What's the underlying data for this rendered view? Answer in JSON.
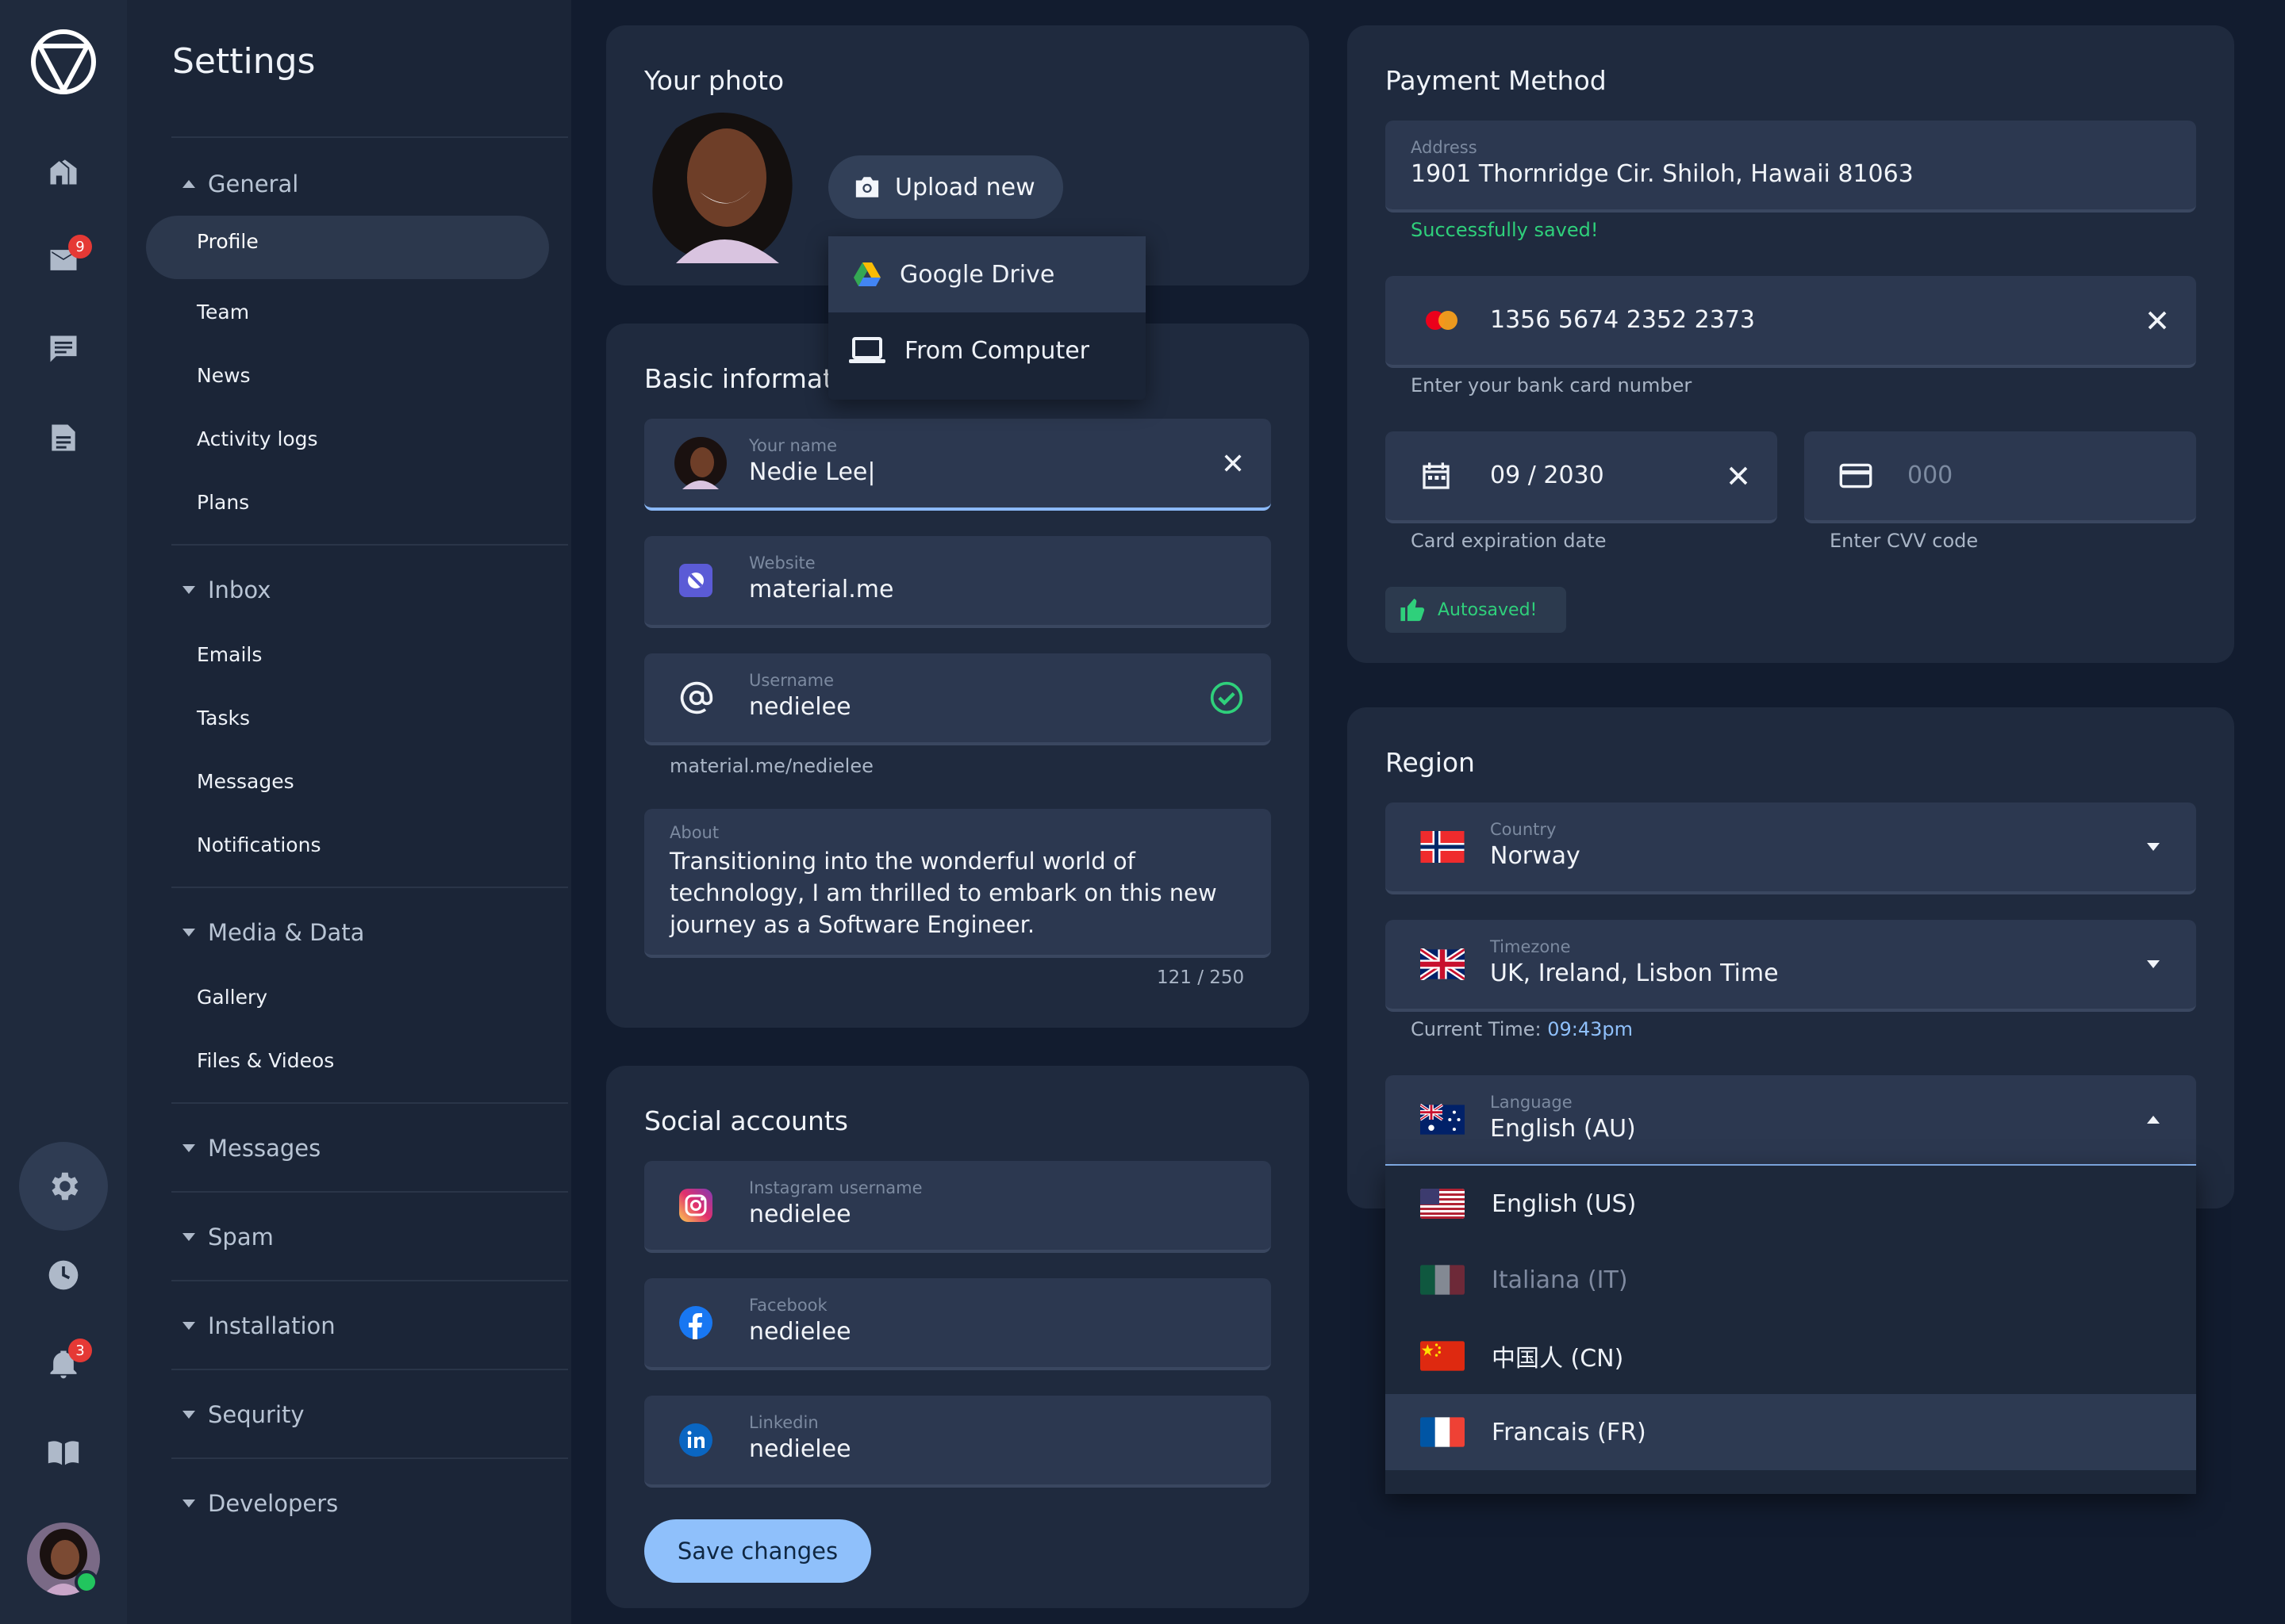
{
  "rail": {
    "mail_badge": "9",
    "bell_badge": "3",
    "icons": [
      "logo-icon",
      "home-icon",
      "mail-icon",
      "chat-icon",
      "document-icon",
      "settings-icon",
      "clock-icon",
      "bell-icon",
      "book-icon"
    ]
  },
  "nav": {
    "title": "Settings",
    "groups": [
      {
        "label": "General",
        "items": [
          "Profile",
          "Team",
          "News",
          "Activity logs",
          "Plans"
        ]
      },
      {
        "label": "Inbox",
        "items": [
          "Emails",
          "Tasks",
          "Messages",
          "Notifications"
        ]
      },
      {
        "label": "Media & Data",
        "items": [
          "Gallery",
          "Files & Videos"
        ]
      },
      {
        "label": "Messages"
      },
      {
        "label": "Spam"
      },
      {
        "label": "Installation"
      },
      {
        "label": "Sequrity"
      },
      {
        "label": "Developers"
      }
    ]
  },
  "photo": {
    "title": "Your photo",
    "upload_label": "Upload new",
    "menu": [
      "Google Drive",
      "From Computer"
    ]
  },
  "basic": {
    "title": "Basic informati",
    "name_label": "Your name",
    "name_value": "Nedie Lee|",
    "website_label": "Website",
    "website_value": "material.me",
    "username_label": "Username",
    "username_value": "nedielee",
    "username_helper": "material.me/nedielee",
    "about_label": "About",
    "about_value": "Transitioning into the wonderful world of technology, I am thrilled to embark on this new journey as a Software Engineer.",
    "about_counter": "121 / 250"
  },
  "social": {
    "title": "Social accounts",
    "instagram_label": "Instagram username",
    "instagram_value": "nedielee",
    "facebook_label": "Facebook",
    "facebook_value": "nedielee",
    "linkedin_label": "Linkedin",
    "linkedin_value": "nedielee",
    "save_label": "Save changes"
  },
  "payment": {
    "title": "Payment Method",
    "address_label": "Address",
    "address_value": "1901 Thornridge Cir. Shiloh, Hawaii 81063",
    "address_status": "Successfully saved!",
    "card_number": "1356 5674 2352 2373",
    "card_helper": "Enter your bank card number",
    "expiry_value": "09 / 2030",
    "expiry_helper": "Card expiration date",
    "cvv_placeholder": "000",
    "cvv_helper": "Enter CVV code",
    "autosave_label": "Autosaved!"
  },
  "region": {
    "title": "Region",
    "country_label": "Country",
    "country_value": "Norway",
    "timezone_label": "Timezone",
    "timezone_value": "UK, Ireland, Lisbon Time",
    "current_time_label": "Current Time:",
    "current_time_value": "09:43pm",
    "language_label": "Language",
    "language_value": "English (AU)",
    "language_options": [
      "English (US)",
      "Italiana (IT)",
      "中国人 (CN)",
      "Francais (FR)"
    ]
  },
  "colors": {
    "accent": "#8fc0fb",
    "success": "#2fd07b",
    "badge": "#e53935",
    "background": "#121c2f"
  }
}
